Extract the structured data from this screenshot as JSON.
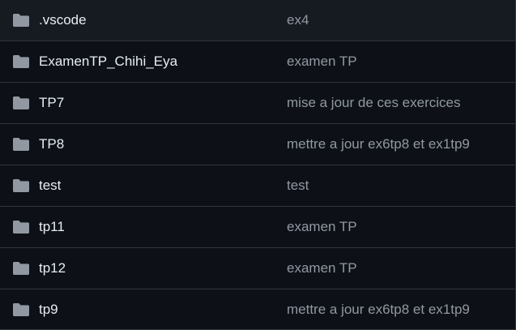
{
  "colors": {
    "background": "#0d1117",
    "border": "#30363d",
    "name_text": "#e6edf3",
    "message_text": "#9198a1",
    "folder_icon": "#9198a1"
  },
  "file_list": {
    "rows": [
      {
        "icon": "folder-icon",
        "name": ".vscode",
        "message": "ex4"
      },
      {
        "icon": "folder-icon",
        "name": "ExamenTP_Chihi_Eya",
        "message": "examen TP"
      },
      {
        "icon": "folder-icon",
        "name": "TP7",
        "message": "mise a jour de ces exercices"
      },
      {
        "icon": "folder-icon",
        "name": "TP8",
        "message": "mettre a jour ex6tp8 et ex1tp9"
      },
      {
        "icon": "folder-icon",
        "name": "test",
        "message": "test"
      },
      {
        "icon": "folder-icon",
        "name": "tp11",
        "message": "examen TP"
      },
      {
        "icon": "folder-icon",
        "name": "tp12",
        "message": "examen TP"
      },
      {
        "icon": "folder-icon",
        "name": "tp9",
        "message": "mettre a jour ex6tp8 et ex1tp9"
      }
    ]
  }
}
